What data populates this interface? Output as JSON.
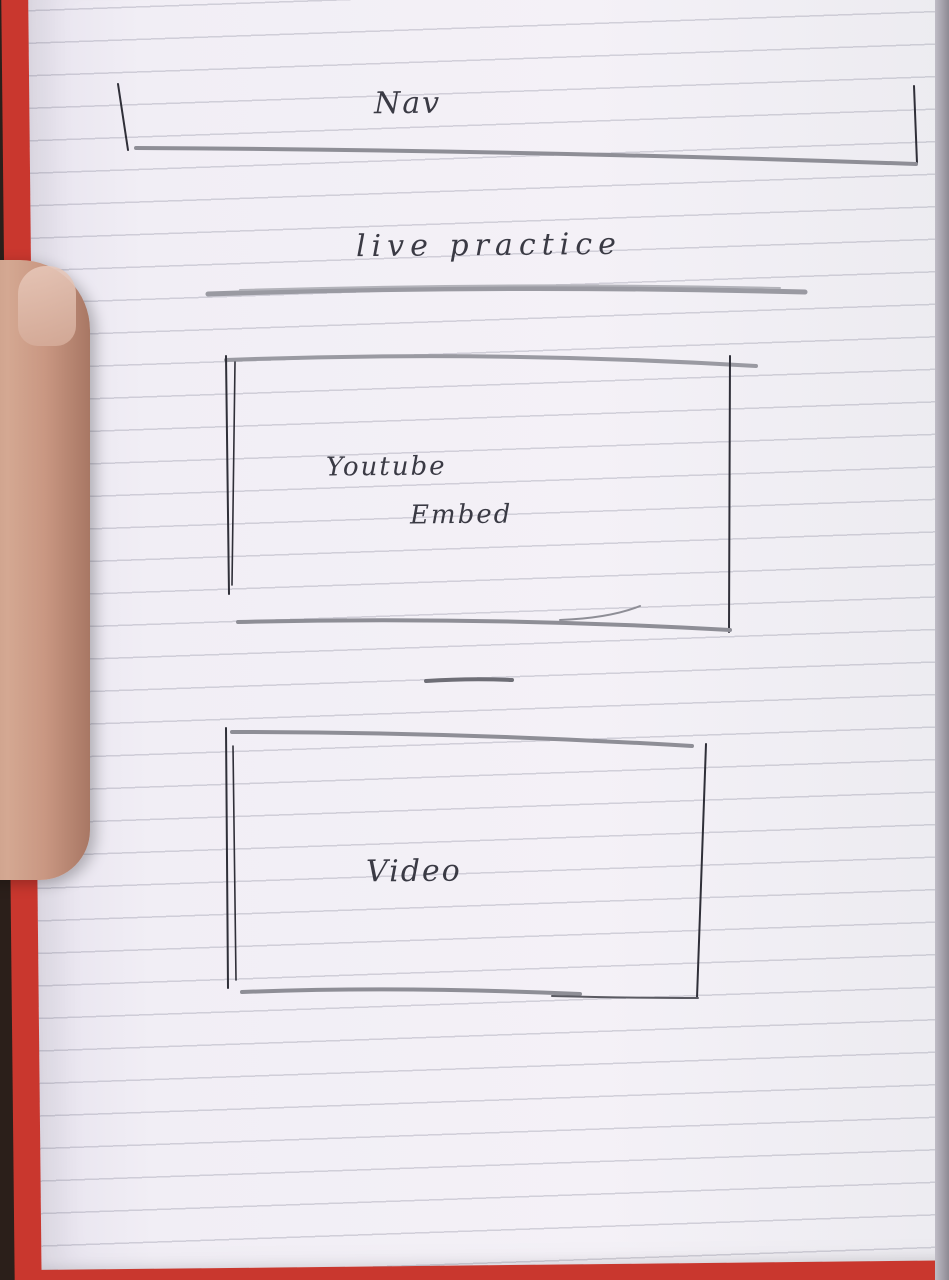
{
  "sketch": {
    "nav_label": "Nav",
    "title_label": "live practice",
    "embed_label_line1": "Youtube",
    "embed_label_line2": "Embed",
    "video_label": "Video"
  },
  "colors": {
    "cover": "#c9372e",
    "paper": "#f1eef5",
    "ink": "#3a3a44",
    "pencil": "#8e8e96"
  }
}
